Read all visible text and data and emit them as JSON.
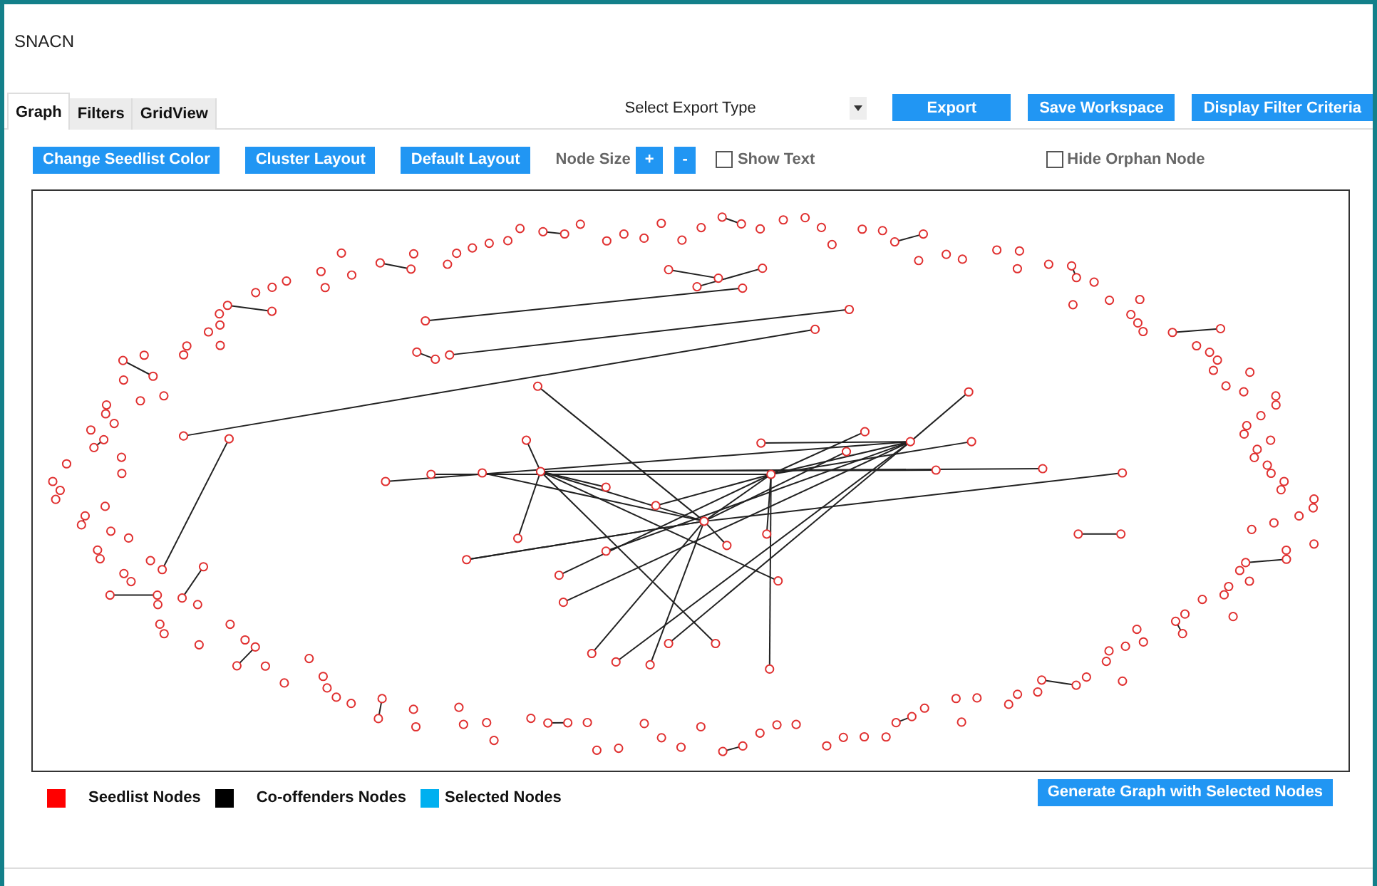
{
  "window": {
    "title": "SNACN"
  },
  "tabs": [
    {
      "label": "Graph",
      "selected": true
    },
    {
      "label": "Filters",
      "selected": false
    },
    {
      "label": "GridView",
      "selected": false
    }
  ],
  "export": {
    "dropdown": "Select Export Type",
    "buttons": [
      "Export",
      "Save Workspace",
      "Display Filter Criteria"
    ]
  },
  "toolbar": {
    "buttons": [
      "Change Seedlist Color",
      "Cluster Layout",
      "Default Layout"
    ],
    "node_size_label": "Node Size",
    "node_size_buttons": [
      "+",
      "-"
    ],
    "checkboxes": [
      {
        "label": "Show Text",
        "checked": false
      },
      {
        "label": "Hide Orphan Node",
        "checked": false
      }
    ]
  },
  "legend": [
    {
      "label": "Seedlist Nodes",
      "color": "#ff0000"
    },
    {
      "label": "Co-offenders Nodes",
      "color": "#000000"
    },
    {
      "label": "Selected Nodes",
      "color": "#00b0f0"
    }
  ],
  "generate_button": "Generate Graph with Selected Nodes"
}
